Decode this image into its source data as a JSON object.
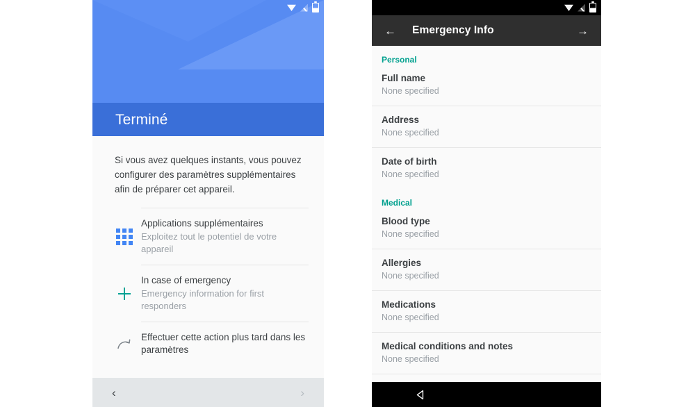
{
  "status_bar": {
    "icons": [
      "wifi-icon",
      "signal-icon",
      "battery-icon"
    ]
  },
  "left_phone": {
    "hero": {
      "title": "Terminé",
      "bg_light": "#5b8ef4",
      "bg_band": "#3a6fd8"
    },
    "intro_text": "Si vous avez quelques instants, vous pouvez configurer des paramètres supplémentaires afin de préparer cet appareil.",
    "options": [
      {
        "icon": "apps-grid-icon",
        "icon_color": "#4285f4",
        "title": "Applications supplémentaires",
        "subtitle": "Exploitez tout le potentiel de votre appareil"
      },
      {
        "icon": "plus-icon",
        "icon_color": "#00a294",
        "title": "In case of emergency",
        "subtitle": "Emergency information for first responders"
      },
      {
        "icon": "redo-later-icon",
        "icon_color": "#7f868c",
        "title": "Effectuer cette action plus tard dans les paramètres",
        "subtitle": ""
      }
    ],
    "navbar": {
      "back_glyph": "‹",
      "forward_glyph": "›"
    }
  },
  "right_phone": {
    "toolbar": {
      "back_glyph": "←",
      "title": "Emergency Info",
      "forward_glyph": "→",
      "bg": "#2f2f2f"
    },
    "section_color": "#00a08e",
    "sections": [
      {
        "header": "Personal",
        "rows": [
          {
            "label": "Full name",
            "value": "None specified"
          },
          {
            "label": "Address",
            "value": "None specified"
          },
          {
            "label": "Date of birth",
            "value": "None specified"
          }
        ]
      },
      {
        "header": "Medical",
        "rows": [
          {
            "label": "Blood type",
            "value": "None specified"
          },
          {
            "label": "Allergies",
            "value": "None specified"
          },
          {
            "label": "Medications",
            "value": "None specified"
          },
          {
            "label": "Medical conditions and notes",
            "value": "None specified"
          }
        ]
      }
    ],
    "navbar": {
      "back_glyph": "back-triangle-icon"
    }
  }
}
